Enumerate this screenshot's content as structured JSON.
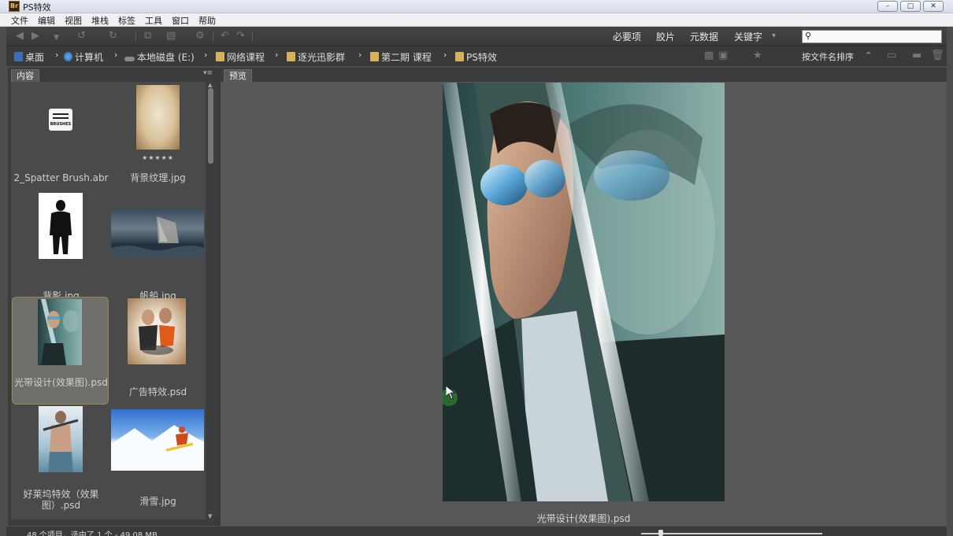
{
  "window": {
    "app_icon": "Br",
    "title": "PS特效",
    "controls": {
      "minimize": "–",
      "maximize": "▢",
      "close": "✕"
    }
  },
  "menu": [
    "文件",
    "编辑",
    "视图",
    "堆栈",
    "标签",
    "工具",
    "窗口",
    "帮助"
  ],
  "toolbar": {
    "workspaces": [
      "必要项",
      "胶片",
      "元数据",
      "关键字"
    ],
    "workspace_dropdown": "▾",
    "search": {
      "value": "",
      "placeholder": ""
    }
  },
  "breadcrumb": [
    "桌面",
    "计算机",
    "本地磁盘 (E:)",
    "网络课程",
    "逐光迅影群",
    "第二期 课程",
    "PS特效"
  ],
  "sort": {
    "label": "按文件名排序"
  },
  "content_panel": {
    "tab": "内容",
    "items": [
      {
        "name": "2_Spatter Brush.abr",
        "icon": "brushes-file-icon",
        "icon_label": "BRUSHES"
      },
      {
        "name": "背景纹理.jpg",
        "rating": "★★★★★"
      },
      {
        "name": "背影.jpg"
      },
      {
        "name": "帆船.jpg"
      },
      {
        "name": "光带设计(效果图).psd",
        "selected": true
      },
      {
        "name": "广告特效.psd"
      },
      {
        "name": "好莱坞特效（效果图）.psd"
      },
      {
        "name": "滑雪.jpg"
      }
    ]
  },
  "preview_panel": {
    "tab": "预览",
    "caption": "光带设计(效果图).psd"
  },
  "status": {
    "text": "48 个项目，选中了 1 个 - 49.08 MB"
  },
  "colors": {
    "panel_bg": "#4a4a4a",
    "selected_border": "#9a8a58",
    "preview_bg": "#575757"
  }
}
